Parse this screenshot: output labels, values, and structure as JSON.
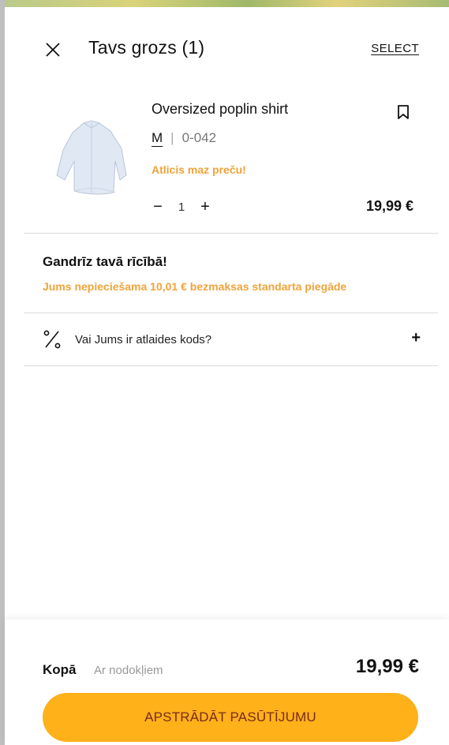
{
  "cart": {
    "title": "Tavs grozs (1)",
    "select_label": "SELECT"
  },
  "item": {
    "name": "Oversized poplin shirt",
    "size": "M",
    "separator": "|",
    "code": "0-042",
    "stock_note": "Atlicis maz preču!",
    "quantity": "1",
    "minus_label": "−",
    "plus_label": "+",
    "price": "19,99 €"
  },
  "shipping": {
    "title": "Gandrīz tavā rīcībā!",
    "note": "Jums nepieciešama 10,01 €  bezmaksas standarta piegāde"
  },
  "discount": {
    "label": "Vai Jums ir atlaides kods?",
    "toggle": "+"
  },
  "footer": {
    "total_label": "Kopā",
    "tax_note": "Ar nodokļiem",
    "total_value": "19,99 €",
    "checkout_label": "APSTRĀDĀT PASŪTĪJUMU"
  },
  "colors": {
    "accent_orange": "#f0a33a",
    "checkout_button": "#ffb11a",
    "checkout_text": "#7a2a1c"
  }
}
